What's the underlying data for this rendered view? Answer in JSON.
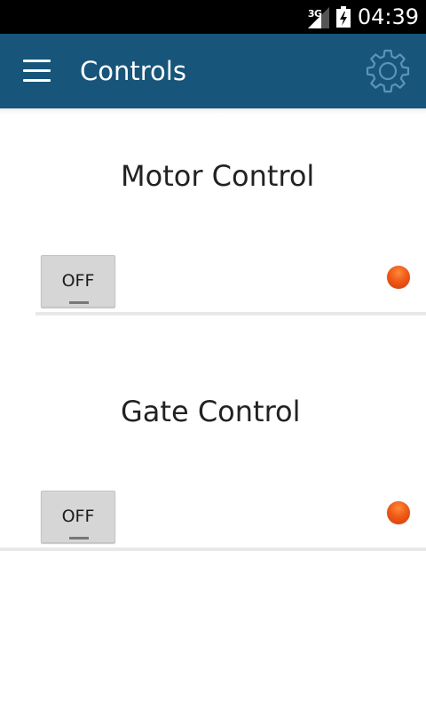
{
  "status_bar": {
    "network": "3G",
    "time": "04:39",
    "icons": [
      "signal-icon",
      "battery-icon"
    ]
  },
  "app_bar": {
    "title": "Controls",
    "background_color": "#17557a",
    "icons": [
      "menu-icon",
      "gear-icon"
    ]
  },
  "controls": [
    {
      "title": "Motor Control",
      "toggle_label": "OFF",
      "status_color": "#ef5a17"
    },
    {
      "title": "Gate Control",
      "toggle_label": "OFF",
      "status_color": "#ef5a17"
    }
  ]
}
